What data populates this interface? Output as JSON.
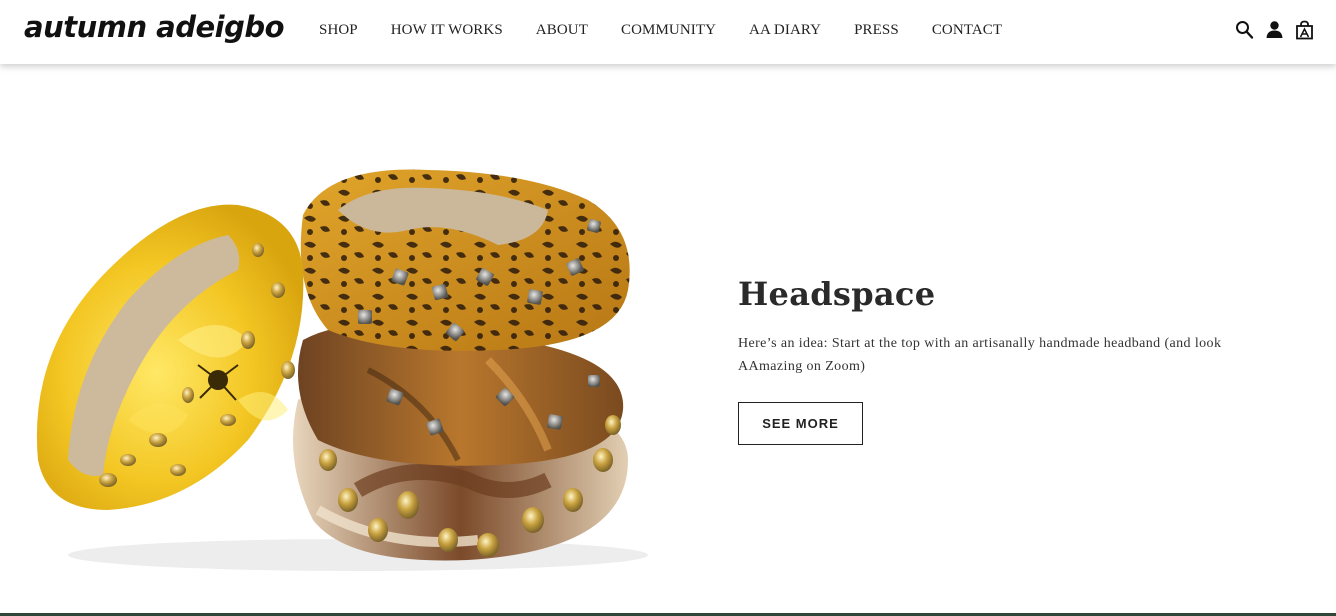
{
  "header": {
    "logo": "autumn adeigbo",
    "nav": [
      {
        "label": "SHOP"
      },
      {
        "label": "HOW IT WORKS"
      },
      {
        "label": "ABOUT"
      },
      {
        "label": "COMMUNITY"
      },
      {
        "label": "AA DIARY"
      },
      {
        "label": "PRESS"
      },
      {
        "label": "CONTACT"
      }
    ],
    "icons": [
      "search-icon",
      "account-icon",
      "cart-icon"
    ]
  },
  "hero": {
    "title": "Headspace",
    "description": "Here’s an idea: Start at the top with an artisanally handmade headband (and look AAmazing on Zoom)",
    "button_label": "SEE MORE"
  },
  "colors": {
    "text": "#222222",
    "yellow": "#f0c020",
    "leopard": "#c8901c",
    "footer_rule": "#2e4637"
  }
}
